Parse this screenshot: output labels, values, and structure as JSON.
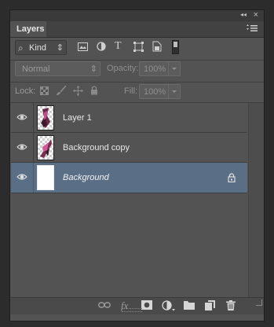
{
  "panel": {
    "tab_label": "Layers",
    "menu_glyph": "☰",
    "collapse_glyph": "◂◂",
    "close_glyph": "×"
  },
  "filter": {
    "kind_label": "Kind",
    "search_glyph": "⌕",
    "stepper_glyph": "⇕",
    "icons": [
      "image-filter-icon",
      "adjustment-filter-icon",
      "type-filter-icon",
      "shape-filter-icon",
      "smart-object-filter-icon",
      "filter-toggle-switch"
    ],
    "type_glyph": "T"
  },
  "blend": {
    "mode_value": "Normal",
    "opacity_label": "Opacity:",
    "opacity_value": "100%"
  },
  "lock": {
    "lock_label": "Lock:",
    "fill_label": "Fill:",
    "fill_value": "100%"
  },
  "layers": [
    {
      "name": "Layer 1",
      "visible": true,
      "selected": false,
      "locked": false
    },
    {
      "name": "Background copy",
      "visible": true,
      "selected": false,
      "locked": false
    },
    {
      "name": "Background",
      "visible": true,
      "selected": true,
      "locked": true
    }
  ],
  "footer": {
    "fx_label": "fx"
  },
  "colors": {
    "panel_bg": "#535353",
    "selected_row": "#5a6e86",
    "app_bg": "#2c2c2c"
  }
}
